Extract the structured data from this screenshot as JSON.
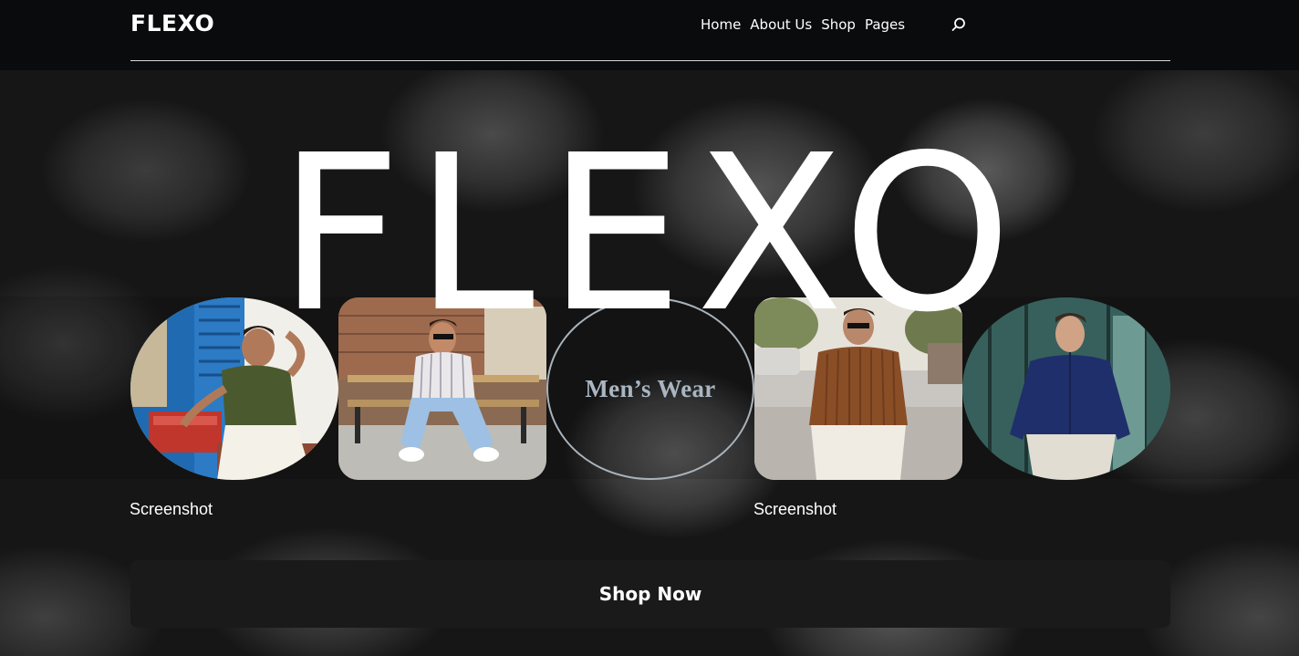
{
  "header": {
    "logo": "FLEXO",
    "nav": [
      "Home",
      "About Us",
      "Shop",
      "Pages"
    ],
    "search_icon": "search-icon"
  },
  "hero": {
    "title": "FLEXO",
    "center_tile_label": "Men’s Wear",
    "captions": [
      "Screenshot",
      "Screenshot"
    ],
    "cta_label": "Shop Now"
  },
  "colors": {
    "header_bg": "#0a0b0c",
    "button_bg": "#1a1a1a",
    "mens_wear_text": "#a9b6c2",
    "circle_border": "#a9b3bb"
  }
}
